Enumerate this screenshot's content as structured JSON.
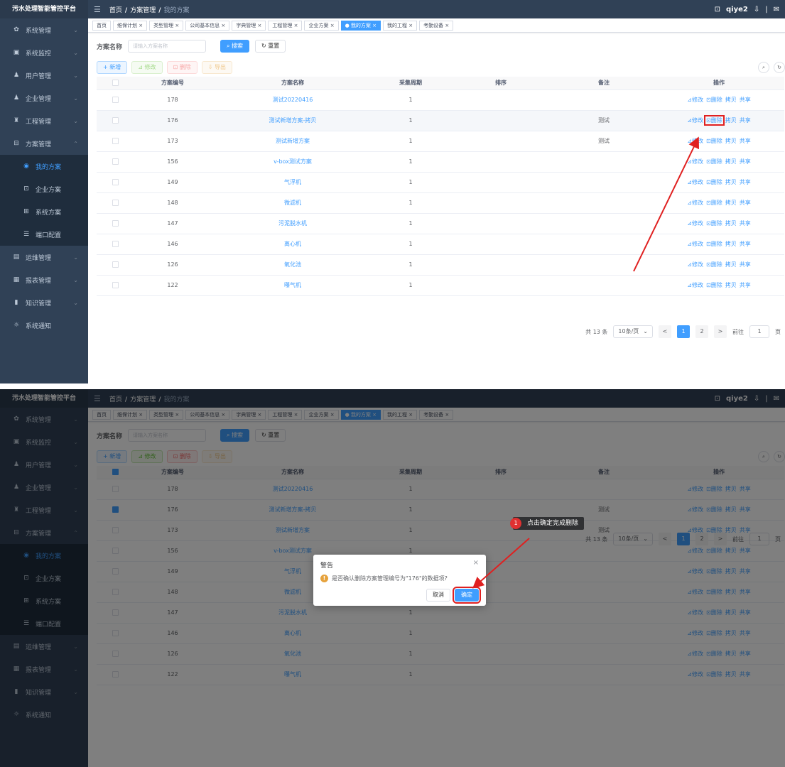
{
  "app_title": "污水处理智能管控平台",
  "sidebar": {
    "items": [
      {
        "label": "系统管理",
        "icon": "gear-icon",
        "glyph": "✿",
        "chev": "⌄"
      },
      {
        "label": "系统监控",
        "icon": "monitor-icon",
        "glyph": "▣",
        "chev": "⌄"
      },
      {
        "label": "用户管理",
        "icon": "user-icon",
        "glyph": "♟",
        "chev": "⌄"
      },
      {
        "label": "企业管理",
        "icon": "company-icon",
        "glyph": "♟",
        "chev": "⌄"
      },
      {
        "label": "工程管理",
        "icon": "project-icon",
        "glyph": "♜",
        "chev": "⌄"
      },
      {
        "label": "方案管理",
        "icon": "plan-icon",
        "glyph": "⊟",
        "chev": "⌃"
      }
    ],
    "sub_items": [
      {
        "label": "我的方案",
        "icon": "target-icon",
        "glyph": "◉"
      },
      {
        "label": "企业方案",
        "icon": "building-icon",
        "glyph": "⊡"
      },
      {
        "label": "系统方案",
        "icon": "doc-icon",
        "glyph": "⊞"
      },
      {
        "label": "端口配置",
        "icon": "sliders-icon",
        "glyph": "☰"
      }
    ],
    "items2": [
      {
        "label": "运维管理",
        "icon": "ops-icon",
        "glyph": "▤",
        "chev": "⌄"
      },
      {
        "label": "报表管理",
        "icon": "report-icon",
        "glyph": "▦",
        "chev": "⌄"
      },
      {
        "label": "知识管理",
        "icon": "book-icon",
        "glyph": "▮",
        "chev": "⌄"
      },
      {
        "label": "系统通知",
        "icon": "bell-icon",
        "glyph": "☼",
        "chev": ""
      }
    ]
  },
  "topbar": {
    "hamburger": "☰",
    "crumbs": [
      "首页",
      "方案管理",
      "我的方案"
    ],
    "sep": "/",
    "user": "qiye2",
    "icon_screen": "⊡",
    "icon_down": "⇩",
    "divider": "|",
    "icon_mail": "✉"
  },
  "tags": [
    {
      "label": "首页",
      "active": false
    },
    {
      "label": "维保计划 ×",
      "active": false
    },
    {
      "label": "类型管理 ×",
      "active": false
    },
    {
      "label": "公司基本信息 ×",
      "active": false
    },
    {
      "label": "字典管理 ×",
      "active": false
    },
    {
      "label": "工程管理 ×",
      "active": false
    },
    {
      "label": "企业方案 ×",
      "active": false
    },
    {
      "label": "● 我的方案 ×",
      "active": true
    },
    {
      "label": "我的工程 ×",
      "active": false
    },
    {
      "label": "考勤设备 ×",
      "active": false
    }
  ],
  "search": {
    "label": "方案名称",
    "placeholder": "请输入方案名称",
    "search_btn": "⌕ 搜索",
    "reset_btn": "↻ 重置"
  },
  "toolbar": {
    "add": "+ 新增",
    "edit": "⊿ 修改",
    "delete": "⊡ 删除",
    "export": "⇩ 导出",
    "circ1": "⌕",
    "circ2": "↻"
  },
  "table": {
    "headers": [
      "方案编号",
      "方案名称",
      "采集周期",
      "排序",
      "备注",
      "操作"
    ],
    "rows": [
      {
        "id": "178",
        "name": "测试20220416",
        "period": "1",
        "sort": "",
        "remark": ""
      },
      {
        "id": "176",
        "name": "测试新增方案-拷贝",
        "period": "1",
        "sort": "",
        "remark": "测试"
      },
      {
        "id": "173",
        "name": "测试新增方案",
        "period": "1",
        "sort": "",
        "remark": "测试"
      },
      {
        "id": "156",
        "name": "v-box测试方案",
        "period": "1",
        "sort": "",
        "remark": ""
      },
      {
        "id": "149",
        "name": "气浮机",
        "period": "1",
        "sort": "",
        "remark": ""
      },
      {
        "id": "148",
        "name": "微滤机",
        "period": "1",
        "sort": "",
        "remark": ""
      },
      {
        "id": "147",
        "name": "污泥脱水机",
        "period": "1",
        "sort": "",
        "remark": ""
      },
      {
        "id": "146",
        "name": "离心机",
        "period": "1",
        "sort": "",
        "remark": ""
      },
      {
        "id": "126",
        "name": "氧化池",
        "period": "1",
        "sort": "",
        "remark": ""
      },
      {
        "id": "122",
        "name": "曝气机",
        "period": "1",
        "sort": "",
        "remark": ""
      }
    ],
    "ops": {
      "edit": "⊿修改",
      "delete": "⊡删除",
      "copy": "拷贝",
      "share": "共享"
    }
  },
  "pager": {
    "total": "共 13 条",
    "size": "10条/页",
    "size_arrow": "⌄",
    "prev": "<",
    "pages": [
      "1",
      "2"
    ],
    "next": ">",
    "goto": "前往",
    "page_input": "1",
    "page_suffix": "页"
  },
  "dialog": {
    "title": "警告",
    "close": "×",
    "warn_glyph": "!",
    "message": "是否确认删除方案管理编号为\"176\"的数据项?",
    "cancel": "取消",
    "confirm": "确定"
  },
  "annotation": {
    "number": "1",
    "text": "点击确定完成删除"
  },
  "colors": {
    "sidebar_bg": "#304156",
    "accent": "#409eff",
    "annotation_red": "#e02020"
  }
}
